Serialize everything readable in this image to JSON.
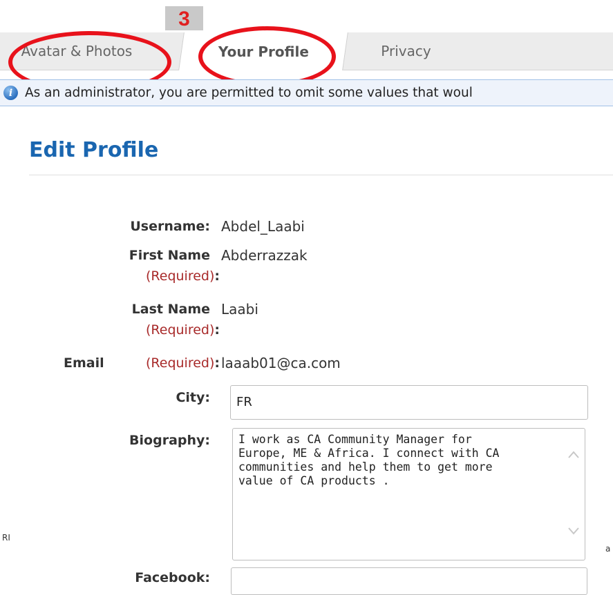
{
  "annotation": {
    "step_number": "3"
  },
  "tabs": [
    {
      "label": "Avatar & Photos"
    },
    {
      "label": "Your Profile"
    },
    {
      "label": "Privacy"
    }
  ],
  "info": {
    "icon": "info-icon",
    "message": "As an administrator, you are permitted to omit some values that woul"
  },
  "page": {
    "title": "Edit Profile"
  },
  "fields": {
    "username": {
      "label": "Username:",
      "value": "Abdel_Laabi"
    },
    "first_name": {
      "label": "First Name",
      "required": "(Required)",
      "colon": ":",
      "value": "Abderrazzak"
    },
    "last_name": {
      "label": "Last Name",
      "required": "(Required)",
      "colon": ":",
      "value": "Laabi"
    },
    "email": {
      "label": "Email",
      "required": "(Required)",
      "colon": ":",
      "value": "laaab01@ca.com"
    },
    "city": {
      "label": "City:",
      "value": "FR"
    },
    "biography": {
      "label": "Biography:",
      "value": "I work as CA Community Manager for\nEurope, ME & Africa. I connect with CA\ncommunities and help them to get more\nvalue of CA products ."
    },
    "facebook": {
      "label": "Facebook:",
      "value": ""
    }
  },
  "edge_fragments": {
    "left": "RI",
    "right": "a"
  },
  "colors": {
    "annotation_red": "#e8121b",
    "title_blue": "#1a66b0",
    "required_red": "#a82a2a"
  }
}
